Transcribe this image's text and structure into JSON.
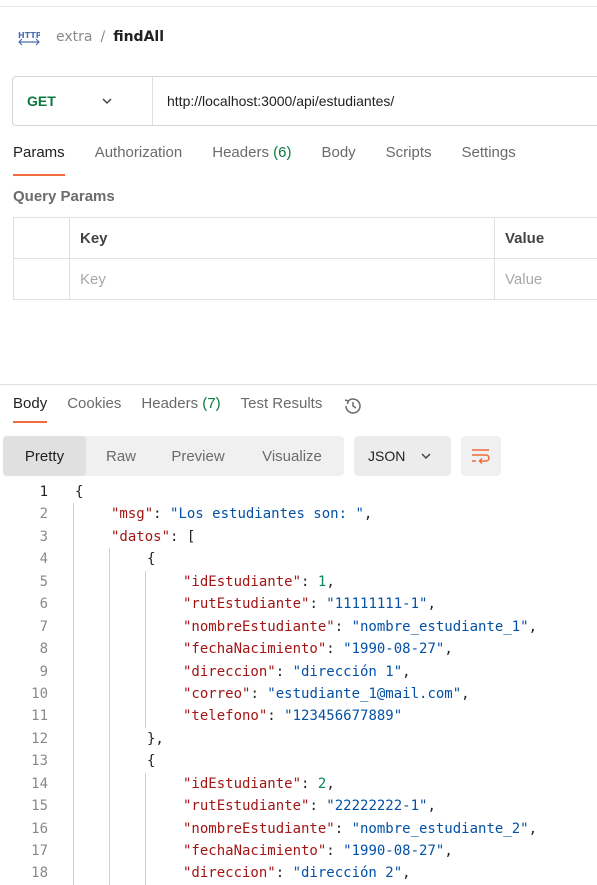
{
  "breadcrumb": {
    "parent": "extra",
    "separator": "/",
    "current": "findAll",
    "icon": "http-icon"
  },
  "request": {
    "method": "GET",
    "url": "http://localhost:3000/api/estudiantes/"
  },
  "request_tabs": [
    {
      "label": "Params",
      "count": "",
      "active": true
    },
    {
      "label": "Authorization",
      "count": "",
      "active": false
    },
    {
      "label": "Headers",
      "count": "(6)",
      "active": false
    },
    {
      "label": "Body",
      "count": "",
      "active": false
    },
    {
      "label": "Scripts",
      "count": "",
      "active": false
    },
    {
      "label": "Settings",
      "count": "",
      "active": false
    }
  ],
  "query_params": {
    "title": "Query Params",
    "headers": {
      "key": "Key",
      "value": "Value"
    },
    "placeholders": {
      "key": "Key",
      "value": "Value"
    }
  },
  "response_tabs": [
    {
      "label": "Body",
      "count": "",
      "active": true
    },
    {
      "label": "Cookies",
      "count": "",
      "active": false
    },
    {
      "label": "Headers",
      "count": "(7)",
      "active": false
    },
    {
      "label": "Test Results",
      "count": "",
      "active": false
    }
  ],
  "view_modes": [
    {
      "label": "Pretty",
      "active": true
    },
    {
      "label": "Raw",
      "active": false
    },
    {
      "label": "Preview",
      "active": false
    },
    {
      "label": "Visualize",
      "active": false
    }
  ],
  "format": "JSON",
  "colors": {
    "accent": "#f26b3a",
    "method": "#0c7a3e",
    "json_key": "#a31515",
    "json_string": "#0451a5",
    "json_number": "#098658"
  },
  "code_lines": [
    {
      "n": "1",
      "indent": 0,
      "parts": [
        {
          "t": "p",
          "v": "{"
        }
      ]
    },
    {
      "n": "2",
      "indent": 1,
      "parts": [
        {
          "t": "k",
          "v": "\"msg\""
        },
        {
          "t": "p",
          "v": ": "
        },
        {
          "t": "s",
          "v": "\"Los estudiantes son: \""
        },
        {
          "t": "p",
          "v": ","
        }
      ]
    },
    {
      "n": "3",
      "indent": 1,
      "parts": [
        {
          "t": "k",
          "v": "\"datos\""
        },
        {
          "t": "p",
          "v": ": ["
        }
      ]
    },
    {
      "n": "4",
      "indent": 2,
      "parts": [
        {
          "t": "p",
          "v": "{"
        }
      ]
    },
    {
      "n": "5",
      "indent": 3,
      "parts": [
        {
          "t": "k",
          "v": "\"idEstudiante\""
        },
        {
          "t": "p",
          "v": ": "
        },
        {
          "t": "n",
          "v": "1"
        },
        {
          "t": "p",
          "v": ","
        }
      ]
    },
    {
      "n": "6",
      "indent": 3,
      "parts": [
        {
          "t": "k",
          "v": "\"rutEstudiante\""
        },
        {
          "t": "p",
          "v": ": "
        },
        {
          "t": "s",
          "v": "\"11111111-1\""
        },
        {
          "t": "p",
          "v": ","
        }
      ]
    },
    {
      "n": "7",
      "indent": 3,
      "parts": [
        {
          "t": "k",
          "v": "\"nombreEstudiante\""
        },
        {
          "t": "p",
          "v": ": "
        },
        {
          "t": "s",
          "v": "\"nombre_estudiante_1\""
        },
        {
          "t": "p",
          "v": ","
        }
      ]
    },
    {
      "n": "8",
      "indent": 3,
      "parts": [
        {
          "t": "k",
          "v": "\"fechaNacimiento\""
        },
        {
          "t": "p",
          "v": ": "
        },
        {
          "t": "s",
          "v": "\"1990-08-27\""
        },
        {
          "t": "p",
          "v": ","
        }
      ]
    },
    {
      "n": "9",
      "indent": 3,
      "parts": [
        {
          "t": "k",
          "v": "\"direccion\""
        },
        {
          "t": "p",
          "v": ": "
        },
        {
          "t": "s",
          "v": "\"dirección 1\""
        },
        {
          "t": "p",
          "v": ","
        }
      ]
    },
    {
      "n": "10",
      "indent": 3,
      "parts": [
        {
          "t": "k",
          "v": "\"correo\""
        },
        {
          "t": "p",
          "v": ": "
        },
        {
          "t": "s",
          "v": "\"estudiante_1@mail.com\""
        },
        {
          "t": "p",
          "v": ","
        }
      ]
    },
    {
      "n": "11",
      "indent": 3,
      "parts": [
        {
          "t": "k",
          "v": "\"telefono\""
        },
        {
          "t": "p",
          "v": ": "
        },
        {
          "t": "s",
          "v": "\"123456677889\""
        }
      ]
    },
    {
      "n": "12",
      "indent": 2,
      "parts": [
        {
          "t": "p",
          "v": "},"
        }
      ]
    },
    {
      "n": "13",
      "indent": 2,
      "parts": [
        {
          "t": "p",
          "v": "{"
        }
      ]
    },
    {
      "n": "14",
      "indent": 3,
      "parts": [
        {
          "t": "k",
          "v": "\"idEstudiante\""
        },
        {
          "t": "p",
          "v": ": "
        },
        {
          "t": "n",
          "v": "2"
        },
        {
          "t": "p",
          "v": ","
        }
      ]
    },
    {
      "n": "15",
      "indent": 3,
      "parts": [
        {
          "t": "k",
          "v": "\"rutEstudiante\""
        },
        {
          "t": "p",
          "v": ": "
        },
        {
          "t": "s",
          "v": "\"22222222-1\""
        },
        {
          "t": "p",
          "v": ","
        }
      ]
    },
    {
      "n": "16",
      "indent": 3,
      "parts": [
        {
          "t": "k",
          "v": "\"nombreEstudiante\""
        },
        {
          "t": "p",
          "v": ": "
        },
        {
          "t": "s",
          "v": "\"nombre_estudiante_2\""
        },
        {
          "t": "p",
          "v": ","
        }
      ]
    },
    {
      "n": "17",
      "indent": 3,
      "parts": [
        {
          "t": "k",
          "v": "\"fechaNacimiento\""
        },
        {
          "t": "p",
          "v": ": "
        },
        {
          "t": "s",
          "v": "\"1990-08-27\""
        },
        {
          "t": "p",
          "v": ","
        }
      ]
    },
    {
      "n": "18",
      "indent": 3,
      "parts": [
        {
          "t": "k",
          "v": "\"direccion\""
        },
        {
          "t": "p",
          "v": ": "
        },
        {
          "t": "s",
          "v": "\"dirección 2\""
        },
        {
          "t": "p",
          "v": ","
        }
      ]
    }
  ]
}
